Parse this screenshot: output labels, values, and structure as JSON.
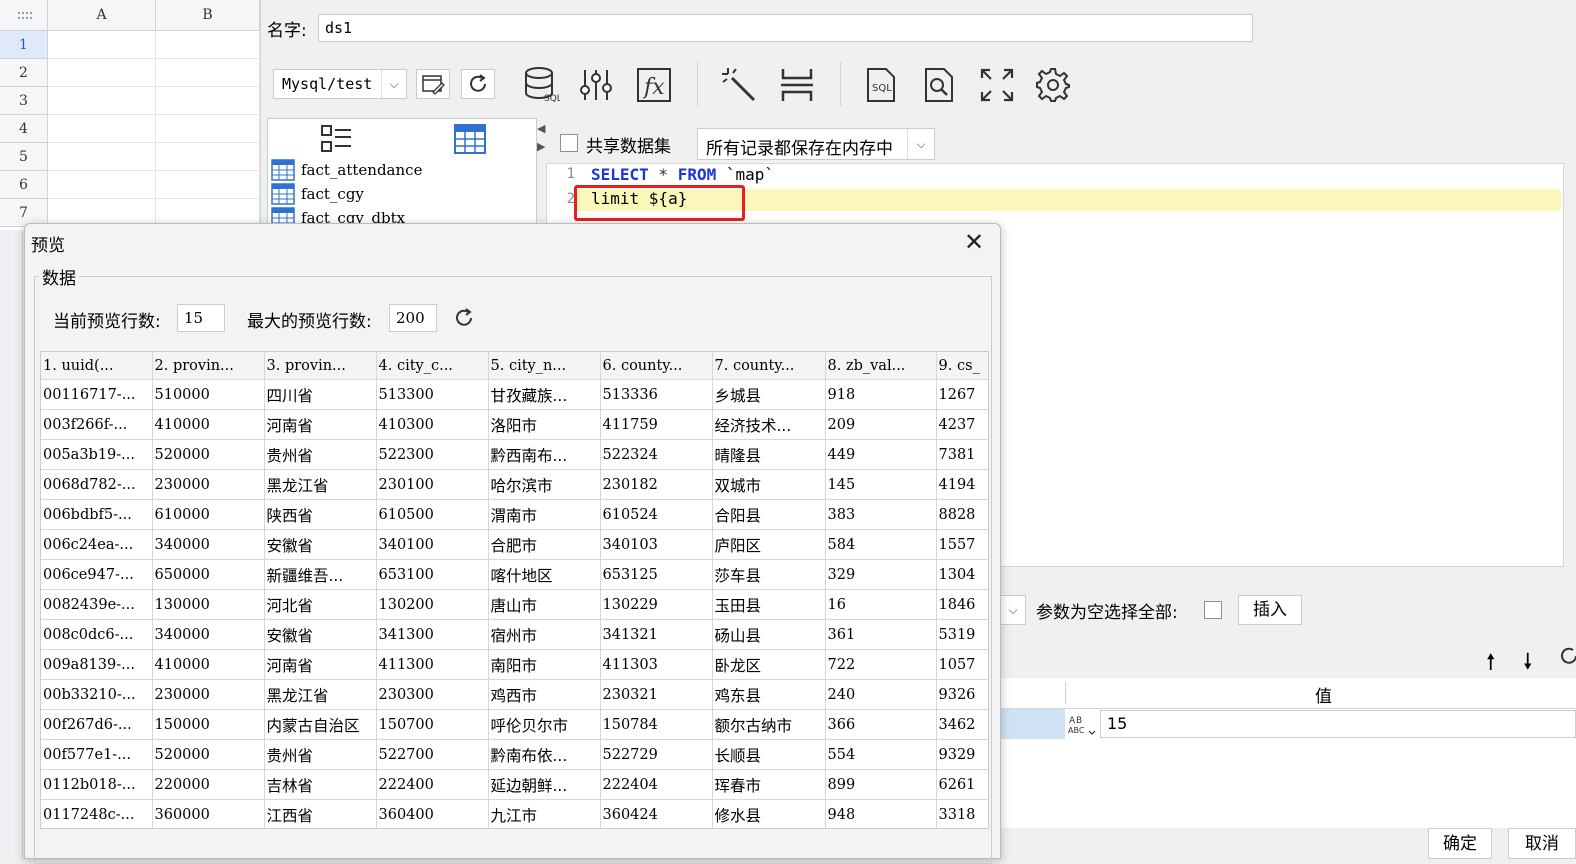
{
  "sheet": {
    "columns": [
      "A",
      "B"
    ],
    "rows": [
      "1",
      "2",
      "3",
      "4",
      "5",
      "6",
      "7"
    ]
  },
  "dataset": {
    "name_label": "名字:",
    "name_value": "ds1",
    "connection": "Mysql/test",
    "tables": [
      "fact_attendance",
      "fact_cgy",
      "fact_cgy_dbtx"
    ],
    "share_label": "共享数据集",
    "memory_option": "所有记录都保存在内存中",
    "sql_lines": [
      {
        "num": "1",
        "kw1": "SELECT",
        "star": " * ",
        "kw2": "FROM",
        "rest": " `map`"
      },
      {
        "num": "2",
        "text": "limit ${a}"
      }
    ],
    "param_empty_label": "参数为空选择全部:",
    "insert_button": "插入",
    "value_header": "值",
    "param_value": "15",
    "ok_button": "确定",
    "cancel_button": "取消"
  },
  "preview": {
    "title": "预览",
    "group": "数据",
    "current_rows_label": "当前预览行数:",
    "current_rows": "15",
    "max_rows_label": "最大的预览行数:",
    "max_rows": "200",
    "columns": [
      "1. uuid(...",
      "2. provin...",
      "3. provin...",
      "4. city_c...",
      "5. city_n...",
      "6. county...",
      "7. county...",
      "8. zb_val...",
      "9. cs_"
    ],
    "rows": [
      [
        "00116717-...",
        "510000",
        "四川省",
        "513300",
        "甘孜藏族...",
        "513336",
        "乡城县",
        "918",
        "1267"
      ],
      [
        "003f266f-...",
        "410000",
        "河南省",
        "410300",
        "洛阳市",
        "411759",
        "经济技术...",
        "209",
        "4237"
      ],
      [
        "005a3b19-...",
        "520000",
        "贵州省",
        "522300",
        "黔西南布...",
        "522324",
        "晴隆县",
        "449",
        "7381"
      ],
      [
        "0068d782-...",
        "230000",
        "黑龙江省",
        "230100",
        "哈尔滨市",
        "230182",
        "双城市",
        "145",
        "4194"
      ],
      [
        "006bdbf5-...",
        "610000",
        "陕西省",
        "610500",
        "渭南市",
        "610524",
        "合阳县",
        "383",
        "8828"
      ],
      [
        "006c24ea-...",
        "340000",
        "安徽省",
        "340100",
        "合肥市",
        "340103",
        "庐阳区",
        "584",
        "1557"
      ],
      [
        "006ce947-...",
        "650000",
        "新疆维吾...",
        "653100",
        "喀什地区",
        "653125",
        "莎车县",
        "329",
        "1304"
      ],
      [
        "0082439e-...",
        "130000",
        "河北省",
        "130200",
        "唐山市",
        "130229",
        "玉田县",
        "16",
        "1846"
      ],
      [
        "008c0dc6-...",
        "340000",
        "安徽省",
        "341300",
        "宿州市",
        "341321",
        "砀山县",
        "361",
        "5319"
      ],
      [
        "009a8139-...",
        "410000",
        "河南省",
        "411300",
        "南阳市",
        "411303",
        "卧龙区",
        "722",
        "1057"
      ],
      [
        "00b33210-...",
        "230000",
        "黑龙江省",
        "230300",
        "鸡西市",
        "230321",
        "鸡东县",
        "240",
        "9326"
      ],
      [
        "00f267d6-...",
        "150000",
        "内蒙古自治区",
        "150700",
        "呼伦贝尔市",
        "150784",
        "额尔古纳市",
        "366",
        "3462"
      ],
      [
        "00f577e1-...",
        "520000",
        "贵州省",
        "522700",
        "黔南布依...",
        "522729",
        "长顺县",
        "554",
        "9329"
      ],
      [
        "0112b018-...",
        "220000",
        "吉林省",
        "222400",
        "延边朝鲜...",
        "222404",
        "珲春市",
        "899",
        "6261"
      ],
      [
        "0117248c-...",
        "360000",
        "江西省",
        "360400",
        "九江市",
        "360424",
        "修水县",
        "948",
        "3318"
      ]
    ]
  }
}
